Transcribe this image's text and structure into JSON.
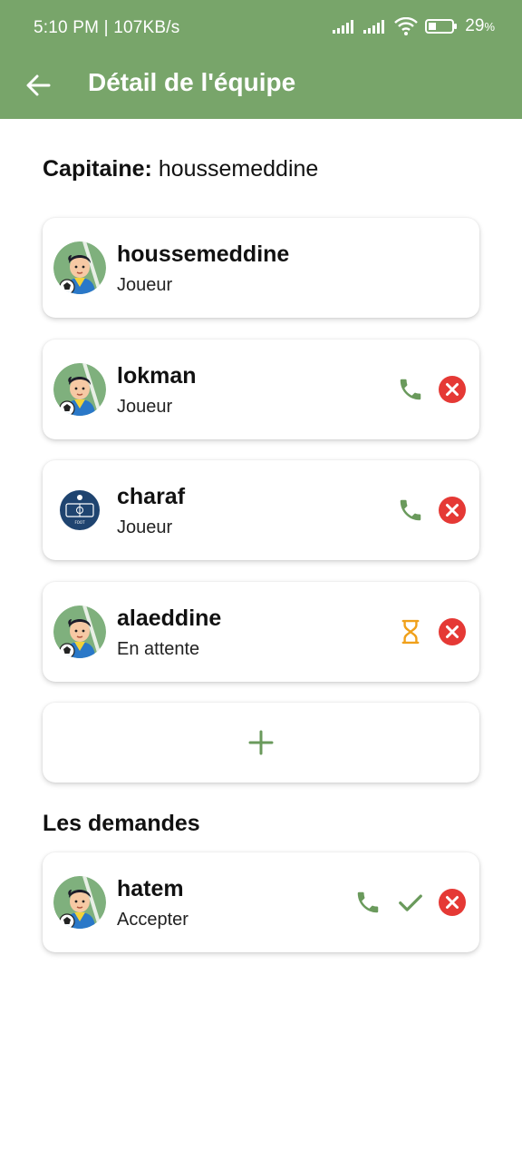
{
  "status_bar": {
    "time": "5:10 PM | 107KB/s",
    "battery": "29",
    "battery_unit": "%"
  },
  "header": {
    "title": "Détail de l'équipe"
  },
  "captain": {
    "label": "Capitaine:",
    "name": "houssemeddine"
  },
  "members": [
    {
      "name": "houssemeddine",
      "role": "Joueur",
      "avatar": "player-avatar"
    },
    {
      "name": "lokman",
      "role": "Joueur",
      "avatar": "player-avatar"
    },
    {
      "name": "charaf",
      "role": "Joueur",
      "avatar": "team-logo-avatar"
    },
    {
      "name": "alaeddine",
      "role": "En attente",
      "avatar": "player-avatar"
    }
  ],
  "add_button": {
    "icon": "plus-icon"
  },
  "requests": {
    "title": "Les demandes",
    "items": [
      {
        "name": "hatem",
        "role": "Accepter",
        "avatar": "player-avatar"
      }
    ]
  },
  "colors": {
    "appbar": "#78a56a",
    "phone": "#6a9a5c",
    "remove": "#e53935",
    "pending": "#f0a01a"
  }
}
